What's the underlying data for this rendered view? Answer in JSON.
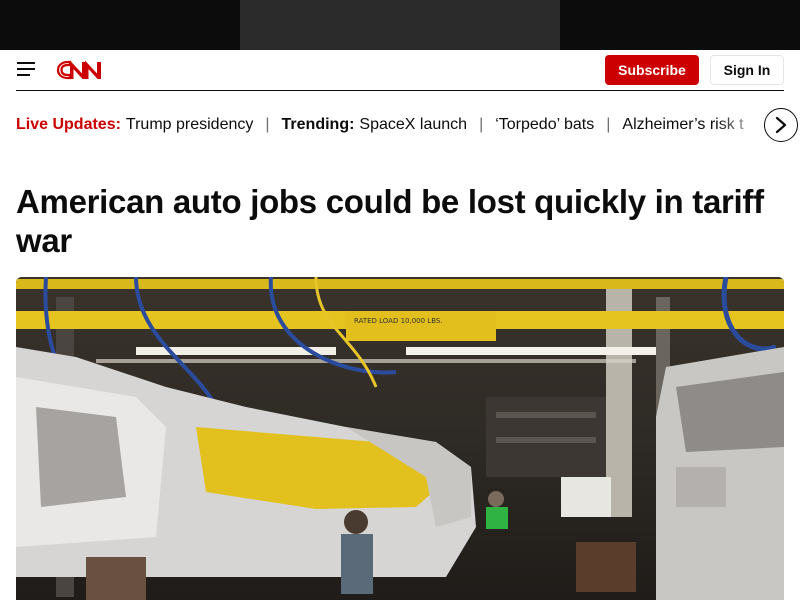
{
  "brand": {
    "logo_text": "CNN",
    "accent": "#cc0000"
  },
  "header": {
    "menu_icon": "hamburger-menu-icon",
    "subscribe_label": "Subscribe",
    "signin_label": "Sign In"
  },
  "ticker": {
    "live_label": "Live Updates:",
    "live_item": "Trump presidency",
    "trending_label": "Trending:",
    "items": [
      "SpaceX launch",
      "‘Torpedo’ bats",
      "Alzheimer’s risk t"
    ],
    "next_icon": "chevron-right-icon"
  },
  "article": {
    "headline": "American auto jobs could be lost quickly in tariff war",
    "image_sign": "RATED LOAD 10,000 LBS."
  }
}
